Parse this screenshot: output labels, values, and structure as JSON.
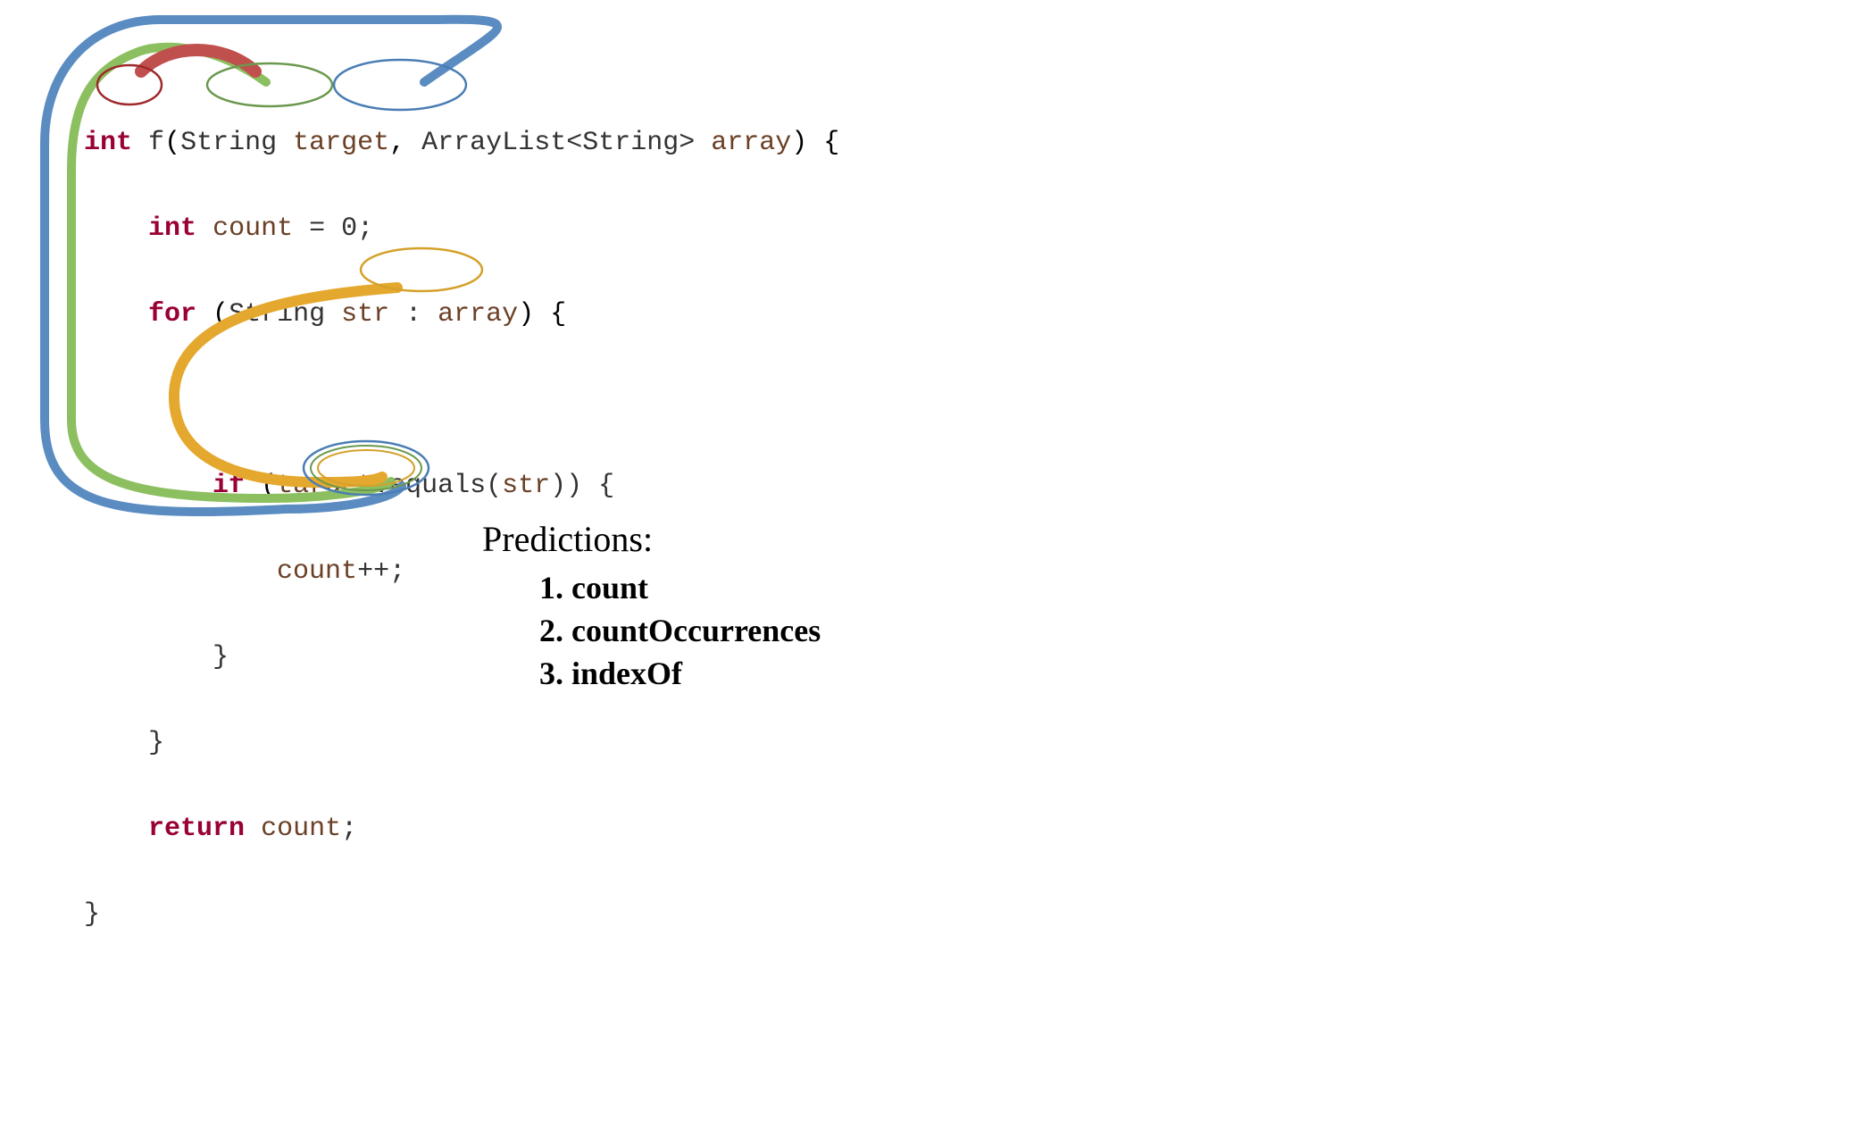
{
  "code": {
    "line1": {
      "kw_int": "int",
      "fn_name": "f",
      "type_string": "String",
      "param_target": "target",
      "type_arraylist": "ArrayList<String>",
      "param_array": "array"
    },
    "line2": {
      "kw_int": "int",
      "var_count": "count",
      "assign": "= 0;"
    },
    "line3": {
      "kw_for": "for",
      "type_string": "String",
      "var_str": "str",
      "colon": ":",
      "var_array": "array"
    },
    "line4": {
      "kw_if": "if",
      "var_target": "target",
      "method": ".equals(",
      "var_str": "str",
      "close": ")) {"
    },
    "line5": {
      "var_count": "count",
      "inc": "++;"
    },
    "line6": {
      "brace": "}"
    },
    "line7": {
      "brace": "}"
    },
    "line8": {
      "kw_return": "return",
      "var_count": "count",
      "semi": ";"
    },
    "line9": {
      "brace": "}"
    }
  },
  "predictions": {
    "title": "Predictions:",
    "items": [
      "count",
      "countOccurrences",
      "indexOf"
    ]
  },
  "annotations": {
    "ellipses": [
      {
        "name": "int-return-type",
        "color": "#9e2a2b"
      },
      {
        "name": "string-param-type",
        "color": "#6a994e"
      },
      {
        "name": "target-param",
        "color": "#4a7db5"
      },
      {
        "name": "target-usage",
        "color": "#d4a12a"
      },
      {
        "name": "count-return-inner1",
        "color": "#d4a12a"
      },
      {
        "name": "count-return-inner2",
        "color": "#6a994e"
      },
      {
        "name": "count-return-outer",
        "color": "#4a7db5"
      }
    ],
    "paths": [
      {
        "name": "blue-path",
        "color": "#5a8cc2",
        "from": "target-param",
        "to": "count-return"
      },
      {
        "name": "green-path",
        "color": "#8bbf5f",
        "from": "string-type",
        "to": "count-return"
      },
      {
        "name": "red-arc",
        "color": "#c0504d",
        "from": "int-type",
        "to": "string-type"
      },
      {
        "name": "orange-path",
        "color": "#e5a82e",
        "from": "target-usage",
        "to": "count-return"
      }
    ]
  }
}
